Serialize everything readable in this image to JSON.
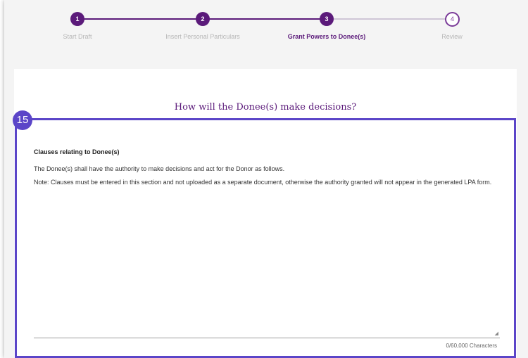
{
  "stepper": {
    "steps": [
      {
        "number": "1",
        "label": "Start Draft",
        "state": "done"
      },
      {
        "number": "2",
        "label": "Insert Personal Particulars",
        "state": "done"
      },
      {
        "number": "3",
        "label": "Grant Powers to Donee(s)",
        "state": "active"
      },
      {
        "number": "4",
        "label": "Review",
        "state": "pending"
      }
    ]
  },
  "card": {
    "title": "How will the Donee(s) make decisions?",
    "annotation_badge": "15",
    "clauses_heading": "Clauses relating to Donee(s)",
    "clauses_intro": "The Donee(s) shall have the authority to make decisions and act for the Donor as follows.",
    "clauses_note": "Note: Clauses must be entered in this section and not uploaded as a separate document, otherwise the authority granted will not appear in the generated LPA form.",
    "textarea_value": "",
    "char_count": "0/60,000 Characters"
  },
  "colors": {
    "brand": "#5b1a7a",
    "annotation": "#5b45c8"
  }
}
